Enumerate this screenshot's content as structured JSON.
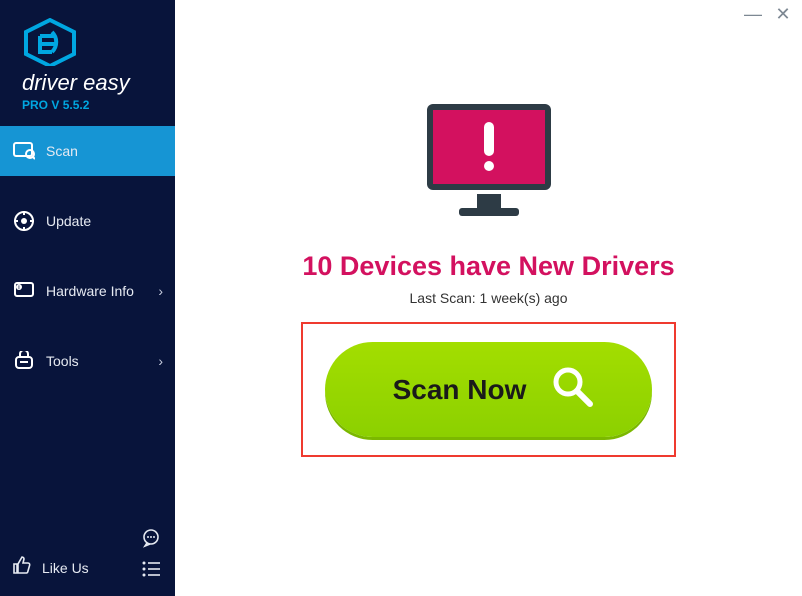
{
  "brand": {
    "name": "driver easy",
    "version_prefix": "PRO V",
    "version": "5.5.2",
    "accent_color": "#00a7e1"
  },
  "sidebar": {
    "items": [
      {
        "label": "Scan",
        "icon": "scan-icon",
        "active": true,
        "has_submenu": false
      },
      {
        "label": "Update",
        "icon": "update-icon",
        "active": false,
        "has_submenu": false
      },
      {
        "label": "Hardware Info",
        "icon": "hardware-info-icon",
        "active": false,
        "has_submenu": true
      },
      {
        "label": "Tools",
        "icon": "tools-icon",
        "active": false,
        "has_submenu": true
      }
    ],
    "like_label": "Like Us"
  },
  "titlebar": {
    "minimize": "—",
    "close": "✕"
  },
  "main": {
    "device_count": 10,
    "headline_template": "Devices have New Drivers",
    "last_scan_label": "Last Scan:",
    "last_scan_value": "1 week(s) ago",
    "scan_button_label": "Scan Now"
  },
  "colors": {
    "headline": "#d3115f",
    "highlight_border": "#ef3a2f",
    "button_green": "#8cd000",
    "sidebar_bg": "#08143b",
    "sidebar_active": "#1695d4"
  }
}
